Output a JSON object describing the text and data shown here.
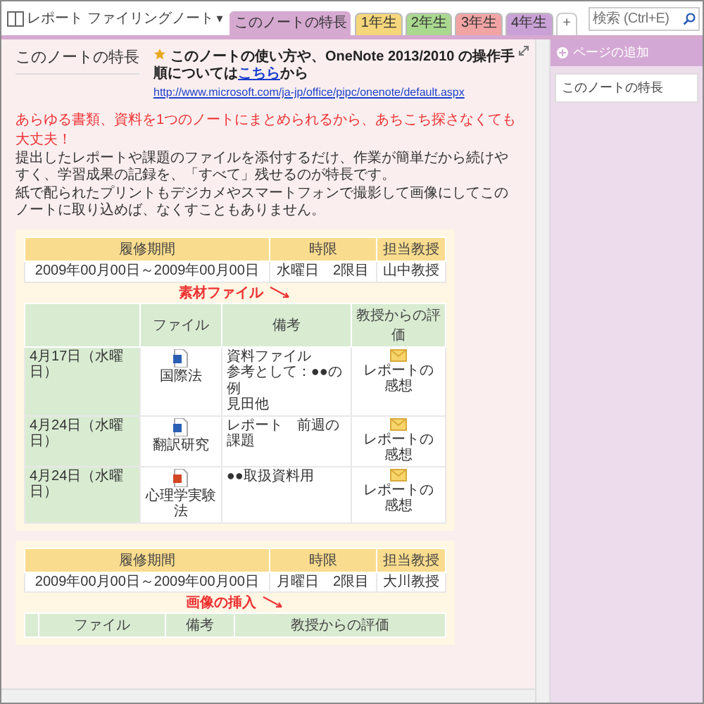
{
  "notebook": {
    "title": "レポート ファイリングノート",
    "caret": "▾"
  },
  "tabs": [
    {
      "label": "このノートの特長",
      "color": "#d6a9d1",
      "selected": true
    },
    {
      "label": "1年生",
      "color": "#f5d67a",
      "selected": false
    },
    {
      "label": "2年生",
      "color": "#a9d88f",
      "selected": false
    },
    {
      "label": "3年生",
      "color": "#f2a3a3",
      "selected": false
    },
    {
      "label": "4年生",
      "color": "#c9a1d6",
      "selected": false
    }
  ],
  "add_tab": "+",
  "search": {
    "placeholder": "検索 (Ctrl+E)"
  },
  "page": {
    "title": "このノートの特長",
    "note": {
      "before": "このノートの使い方や、OneNote 2013/2010 の操作手順については",
      "link": "こちら",
      "after": "から",
      "url": "http://www.microsoft.com/ja-jp/office/pipc/onenote/default.aspx"
    },
    "headline": "あらゆる書類、資料を1つのノートにまとめられるから、あちこち探さなくても大丈夫！",
    "paragraphs": [
      "提出したレポートや課題のファイルを添付するだけ、作業が簡単だから続けやすく、学習成果の記録を、「すべて」残せるのが特長です。",
      "紙で配られたプリントもデジカメやスマートフォンで撮影して画像にしてこのノートに取り込めば、なくすこともありません。"
    ],
    "sections": [
      {
        "schedule": {
          "columns": [
            "履修期間",
            "時限",
            "担当教授"
          ],
          "row": [
            "2009年00月00日～2009年00月00日",
            "水曜日　2限目",
            "山中教授"
          ]
        },
        "annotation": "素材ファイル",
        "files": {
          "columns": [
            "",
            "ファイル",
            "備考",
            "教授からの評価"
          ],
          "rows": [
            {
              "date": "4月17日（水曜日）",
              "file": {
                "kind": "word",
                "name": "国際法"
              },
              "remarks": [
                "資料ファイル",
                "参考として：●●の例",
                "見田他"
              ],
              "evaluation": "レポートの感想"
            },
            {
              "date": "4月24日（水曜日）",
              "file": {
                "kind": "word",
                "name": "翻訳研究"
              },
              "remarks": [
                "レポート　前週の課題"
              ],
              "evaluation": "レポートの感想"
            },
            {
              "date": "4月24日（水曜日）",
              "file": {
                "kind": "powerpoint",
                "name": "心理学実験法"
              },
              "remarks": [
                "●●取扱資料用"
              ],
              "evaluation": "レポートの感想"
            }
          ]
        }
      },
      {
        "schedule": {
          "columns": [
            "履修期間",
            "時限",
            "担当教授"
          ],
          "row": [
            "2009年00月00日～2009年00月00日",
            "月曜日　2限目",
            "大川教授"
          ]
        },
        "annotation": "画像の挿入",
        "files": {
          "columns": [
            "",
            "ファイル",
            "備考",
            "教授からの評価"
          ]
        }
      }
    ]
  },
  "sidebar": {
    "add_page": "ページの追加",
    "pages": [
      {
        "title": "このノートの特長",
        "selected": true
      }
    ]
  }
}
